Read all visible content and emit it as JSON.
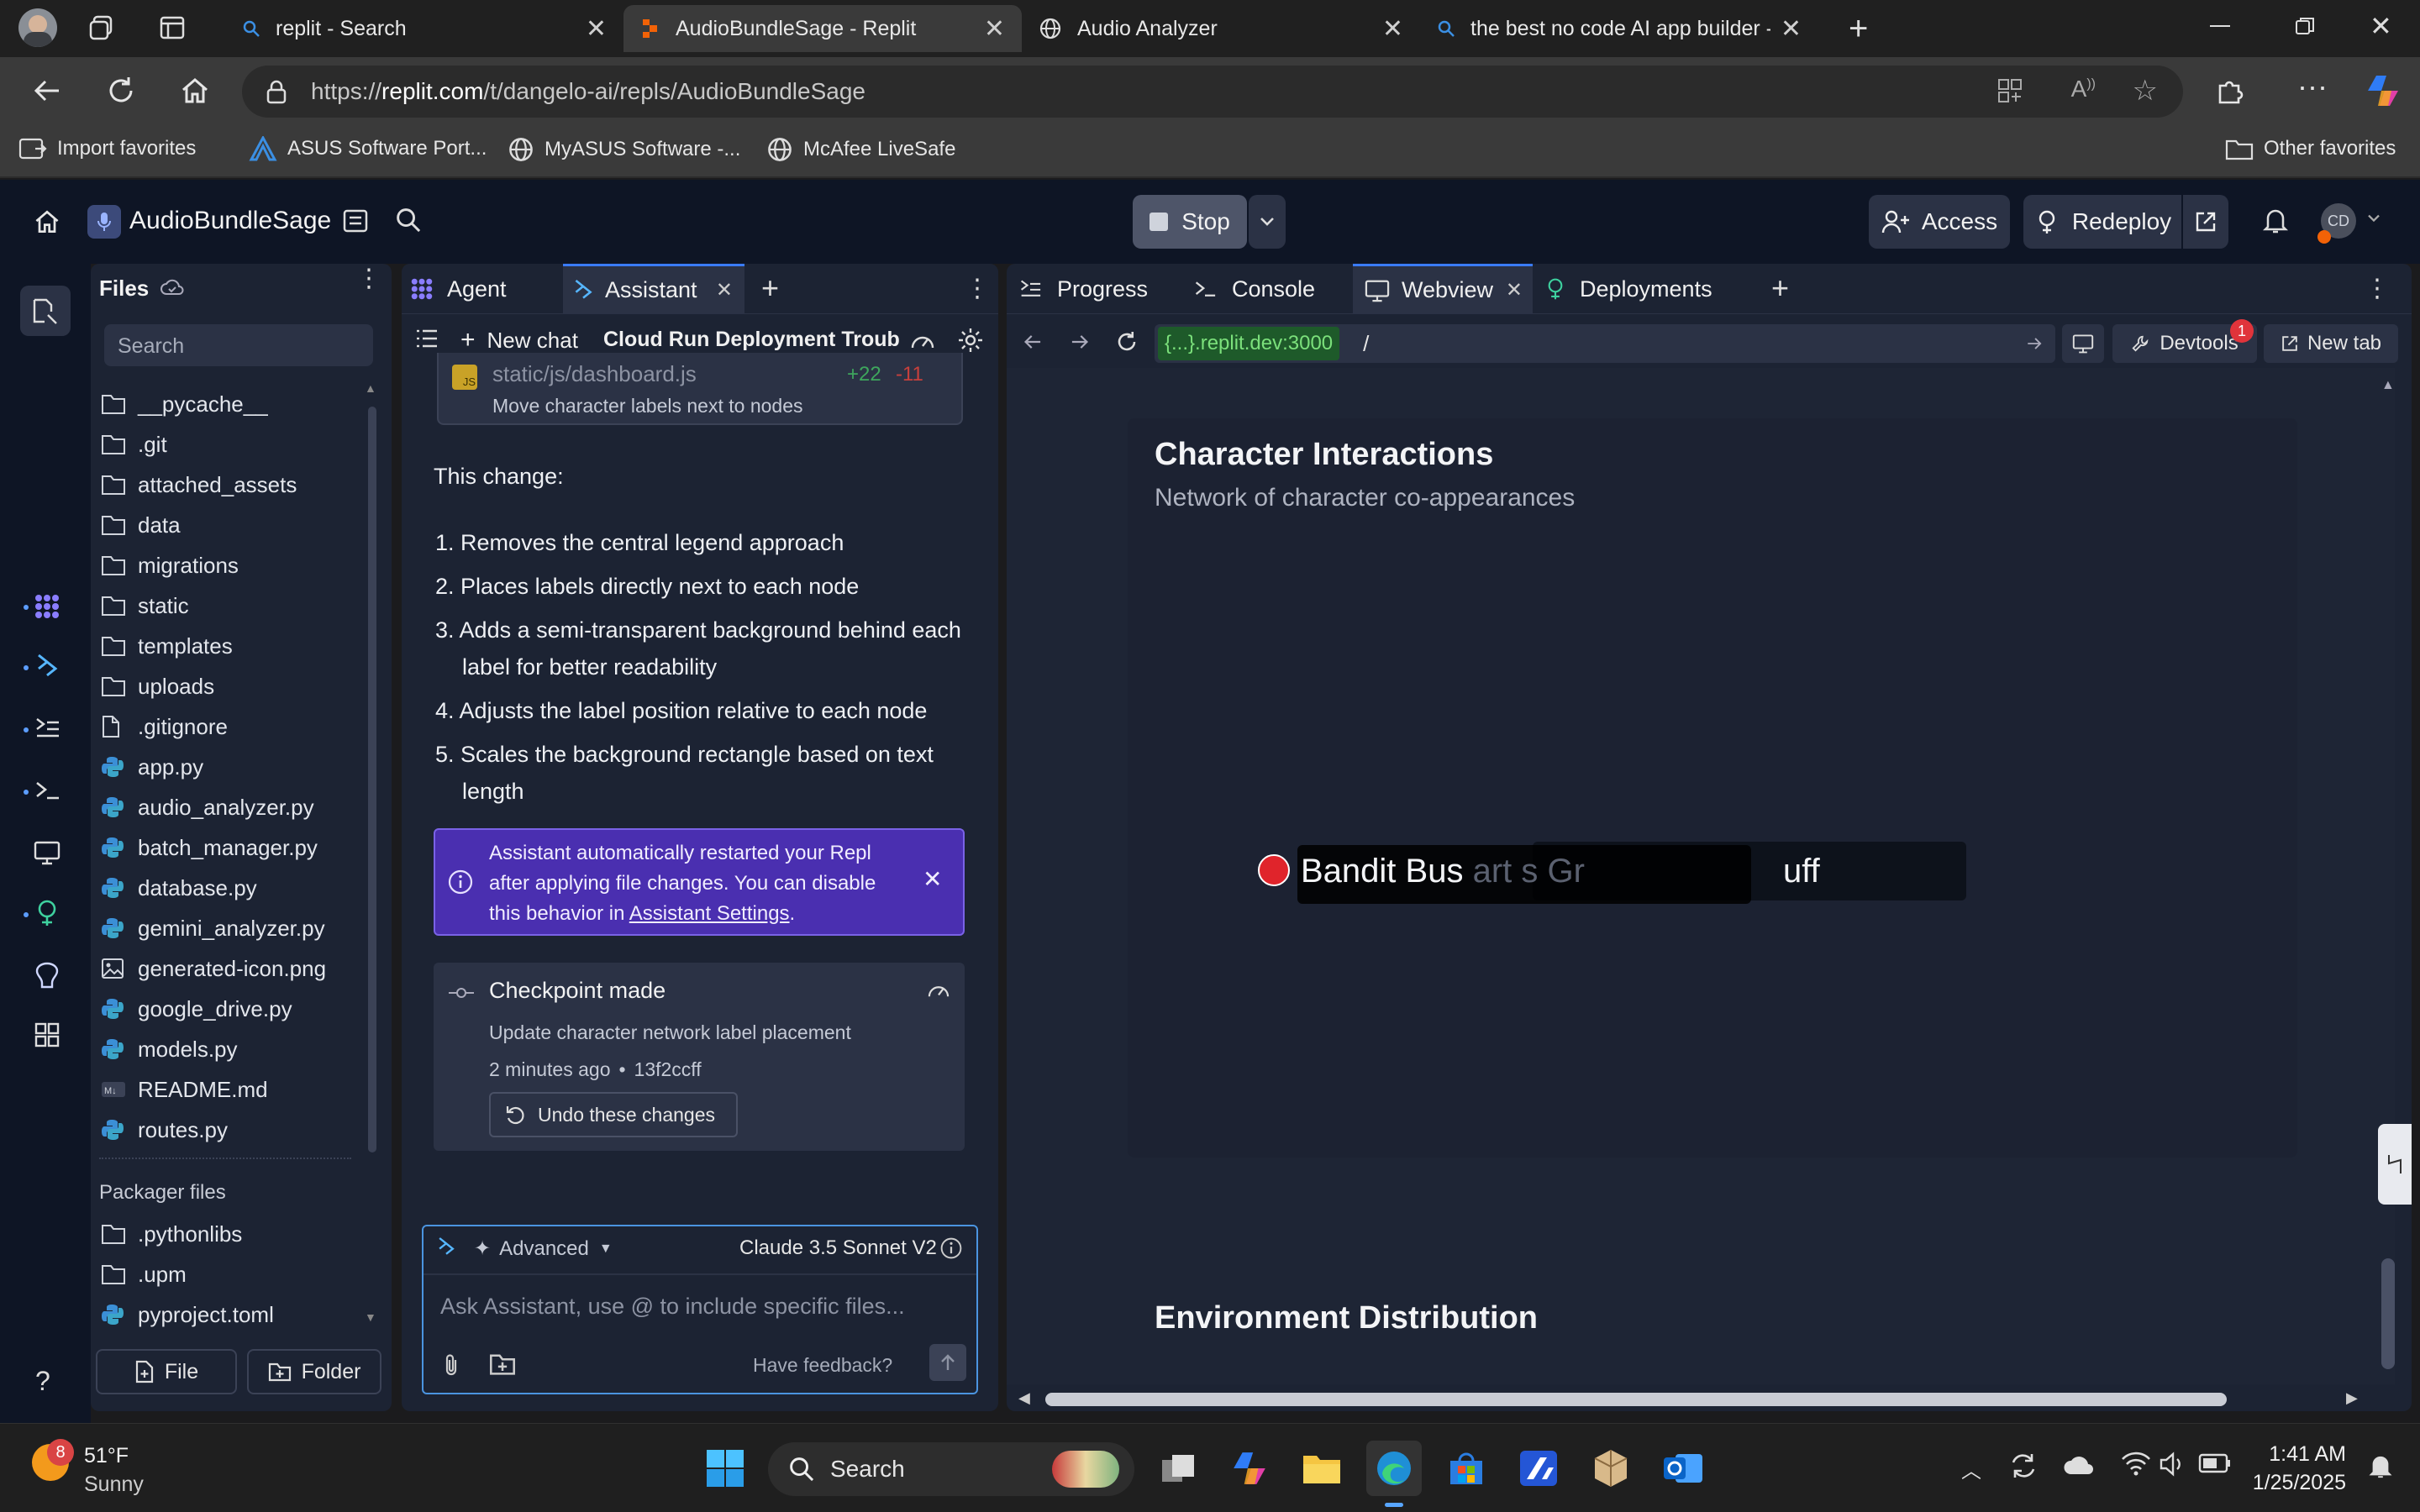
{
  "browser": {
    "tabs": [
      {
        "title": "replit - Search",
        "active": false
      },
      {
        "title": "AudioBundleSage - Replit",
        "active": true
      },
      {
        "title": "Audio Analyzer",
        "active": false
      },
      {
        "title": "the best no code AI app builder -",
        "active": false
      }
    ],
    "url_prefix": "https://",
    "url_domain": "replit.com",
    "url_path": "/t/dangelo-ai/repls/AudioBundleSage",
    "favorites": [
      "Import favorites",
      "ASUS Software Port...",
      "MyASUS Software -...",
      "McAfee LiveSafe"
    ],
    "other_favorites": "Other favorites"
  },
  "replit": {
    "project_name": "AudioBundleSage",
    "stop_label": "Stop",
    "access_label": "Access",
    "redeploy_label": "Redeploy",
    "avatar_initials": "CD"
  },
  "files": {
    "title": "Files",
    "search_placeholder": "Search",
    "items": [
      {
        "name": "__pycache__",
        "type": "folder"
      },
      {
        "name": ".git",
        "type": "folder"
      },
      {
        "name": "attached_assets",
        "type": "folder"
      },
      {
        "name": "data",
        "type": "folder"
      },
      {
        "name": "migrations",
        "type": "folder"
      },
      {
        "name": "static",
        "type": "folder"
      },
      {
        "name": "templates",
        "type": "folder"
      },
      {
        "name": "uploads",
        "type": "folder"
      },
      {
        "name": ".gitignore",
        "type": "file"
      },
      {
        "name": "app.py",
        "type": "python"
      },
      {
        "name": "audio_analyzer.py",
        "type": "python"
      },
      {
        "name": "batch_manager.py",
        "type": "python"
      },
      {
        "name": "database.py",
        "type": "python"
      },
      {
        "name": "gemini_analyzer.py",
        "type": "python"
      },
      {
        "name": "generated-icon.png",
        "type": "image"
      },
      {
        "name": "google_drive.py",
        "type": "python"
      },
      {
        "name": "models.py",
        "type": "python"
      },
      {
        "name": "README.md",
        "type": "markdown"
      },
      {
        "name": "routes.py",
        "type": "python"
      }
    ],
    "packager_title": "Packager files",
    "packager_items": [
      {
        "name": ".pythonlibs",
        "type": "folder"
      },
      {
        "name": ".upm",
        "type": "folder"
      },
      {
        "name": "pyproject.toml",
        "type": "python"
      }
    ],
    "new_file_label": "File",
    "new_folder_label": "Folder"
  },
  "assistant": {
    "tabs": [
      "Agent",
      "Assistant"
    ],
    "new_chat_label": "New chat",
    "chat_title": "Cloud Run Deployment Troub...",
    "file_change": {
      "path": "static/js/dashboard.js",
      "added": "+22",
      "removed": "-11",
      "description": "Move character labels next to nodes",
      "badge": "JS"
    },
    "intro": "This change:",
    "steps": [
      {
        "num": "1.",
        "text": "Removes the central legend approach"
      },
      {
        "num": "2.",
        "text": "Places labels directly next to each node"
      },
      {
        "num": "3.",
        "text": "Adds a semi-transparent background behind each label for better readability"
      },
      {
        "num": "4.",
        "text": "Adjusts the label position relative to each node"
      },
      {
        "num": "5.",
        "text": "Scales the background rectangle based on text length"
      }
    ],
    "notice_text": "Assistant automatically restarted your Repl after applying file changes. You can disable this behavior in ",
    "notice_link": "Assistant Settings",
    "notice_end": ".",
    "checkpoint": {
      "title": "Checkpoint made",
      "description": "Update character network label placement",
      "time": "2 minutes ago",
      "commit": "13f2ccff",
      "undo_label": "Undo these changes"
    },
    "mode_label": "Advanced",
    "model_label": "Claude 3.5 Sonnet V2",
    "input_placeholder": "Ask Assistant, use @ to include specific files...",
    "feedback_label": "Have feedback?"
  },
  "webview": {
    "tabs": [
      "Progress",
      "Console",
      "Webview",
      "Deployments"
    ],
    "url_host": "{...}.replit.dev:3000",
    "url_path": "/",
    "devtools_label": "Devtools",
    "devtools_badge": "1",
    "new_tab_label": "New tab",
    "section1_title": "Character Interactions",
    "section1_subtitle": "Network of character co-appearances",
    "node_label_front": "Bandit Bus",
    "node_label_ghost": "Bandit Bus  art  s Gr",
    "node_label_tail": "uff",
    "node_color": "#e0242b",
    "section2_title": "Environment Distribution"
  },
  "taskbar": {
    "weather_badge": "8",
    "temperature": "51°F",
    "condition": "Sunny",
    "search_label": "Search",
    "time": "1:41 AM",
    "date": "1/25/2025"
  },
  "colors": {
    "accent_purple": "#4a2fb0",
    "replit_bg": "#0e1525",
    "panel_bg": "#1c2333"
  }
}
